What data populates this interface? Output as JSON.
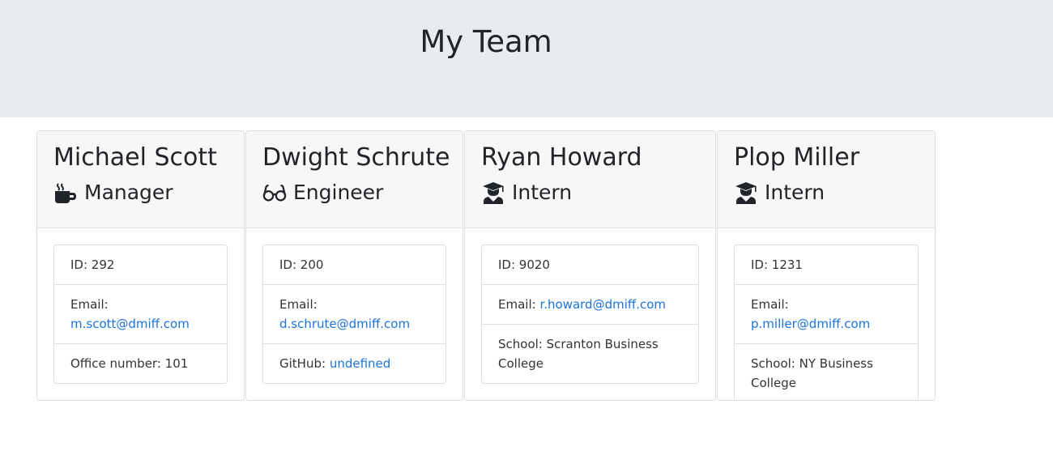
{
  "page": {
    "title": "My Team"
  },
  "members": [
    {
      "name": "Michael Scott",
      "role": "Manager",
      "role_icon": "mug-icon",
      "id_text": "ID: 292",
      "email_label": "Email: ",
      "email": "m.scott@dmiff.com",
      "extra_label": "Office number: ",
      "extra_value": "101"
    },
    {
      "name": "Dwight Schrute",
      "role": "Engineer",
      "role_icon": "glasses-icon",
      "id_text": "ID: 200",
      "email_label": "Email: ",
      "email": "d.schrute@dmiff.com",
      "extra_label": "GitHub: ",
      "extra_value": "undefined"
    },
    {
      "name": "Ryan Howard",
      "role": "Intern",
      "role_icon": "user-graduate-icon",
      "id_text": "ID: 9020",
      "email_label": "Email: ",
      "email": "r.howard@dmiff.com",
      "extra_label": "School: ",
      "extra_value": "Scranton Business College"
    },
    {
      "name": "Plop Miller",
      "role": "Intern",
      "role_icon": "user-graduate-icon",
      "id_text": "ID: 1231",
      "email_label": "Email: ",
      "email": "p.miller@dmiff.com",
      "extra_label": "School: ",
      "extra_value": "NY Business College"
    }
  ],
  "colors": {
    "header_bg": "#e9ecef",
    "link": "#1a73d9",
    "text": "#212529"
  }
}
